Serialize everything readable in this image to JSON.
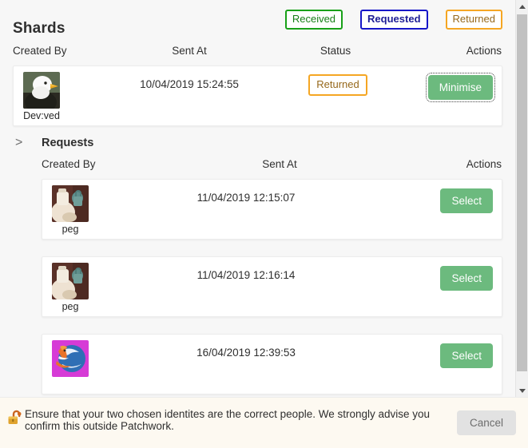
{
  "header": {
    "title": "Shards",
    "legend": [
      {
        "label": "Received",
        "border": "#18a018",
        "text": "#157f15"
      },
      {
        "label": "Requested",
        "border": "#1616c8",
        "text": "#1d1d96"
      },
      {
        "label": "Returned",
        "border": "#f5a623",
        "text": "#96681b"
      }
    ]
  },
  "shards_table": {
    "columns": [
      "Created By",
      "Sent At",
      "Status",
      "Actions"
    ],
    "rows": [
      {
        "created_by": "Dev:ved",
        "avatar": "eagle-avatar",
        "sent_at": "10/04/2019 15:24:55",
        "status": "Returned",
        "action_label": "Minimise"
      }
    ]
  },
  "requests_section": {
    "chevron": ">",
    "title": "Requests",
    "columns": [
      "Created By",
      "Sent At",
      "Actions"
    ],
    "rows": [
      {
        "created_by": "peg",
        "avatar": "peg-avatar",
        "sent_at": "11/04/2019 12:15:07",
        "action_label": "Select"
      },
      {
        "created_by": "peg",
        "avatar": "peg-avatar",
        "sent_at": "11/04/2019 12:16:14",
        "action_label": "Select"
      },
      {
        "created_by": "",
        "avatar": "firefox-avatar",
        "sent_at": "16/04/2019 12:39:53",
        "action_label": "Select"
      }
    ]
  },
  "notice": {
    "icon": "unlocked-padlock-icon",
    "text": "Ensure that your two chosen identites are the correct people. We strongly advise you confirm this outside Patchwork.",
    "cancel_label": "Cancel"
  },
  "colors": {
    "green_button": "#6cba7e",
    "page_background": "#f7f7f7",
    "card_background": "#ffffff",
    "notice_background": "#fdf9f1",
    "scrollbar_thumb": "#c1c1c1"
  },
  "scrollbar": {
    "up_arrow": "scroll-up-arrow",
    "down_arrow": "scroll-down-arrow"
  }
}
